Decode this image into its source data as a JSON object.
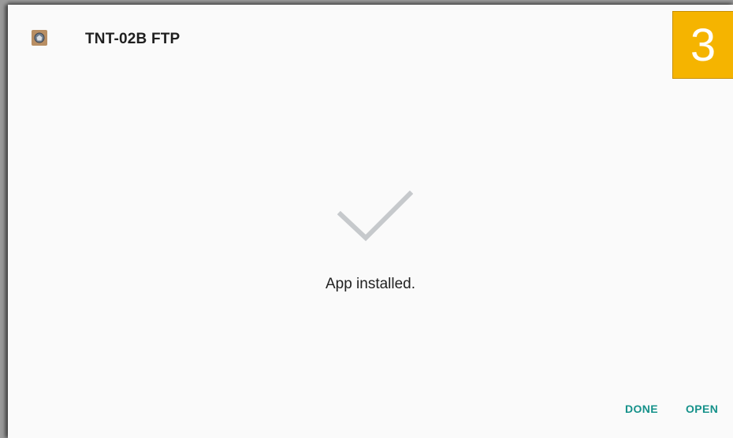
{
  "header": {
    "app_icon": "app-icon",
    "title": "TNT-02B FTP"
  },
  "badge": {
    "number": "3",
    "color": "#f5b400"
  },
  "main": {
    "status_icon": "checkmark-icon",
    "status_text": "App installed."
  },
  "actions": {
    "done_label": "DONE",
    "open_label": "OPEN",
    "accent_color": "#15918a"
  }
}
